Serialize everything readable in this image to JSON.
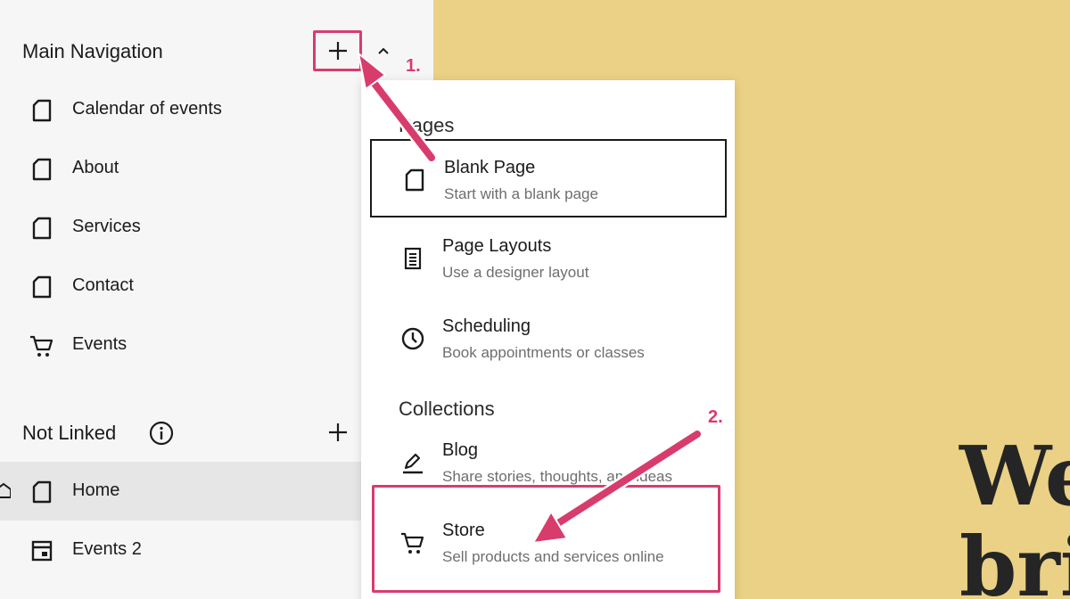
{
  "sidebar": {
    "main_nav_title": "Main Navigation",
    "main_nav_items": [
      {
        "label": "Calendar of events",
        "icon": "page-icon"
      },
      {
        "label": "About",
        "icon": "page-icon"
      },
      {
        "label": "Services",
        "icon": "page-icon"
      },
      {
        "label": "Contact",
        "icon": "page-icon"
      },
      {
        "label": "Events",
        "icon": "cart-icon"
      }
    ],
    "not_linked_title": "Not Linked",
    "not_linked_items": [
      {
        "label": "Home",
        "icon": "page-icon",
        "selected": true
      },
      {
        "label": "Events 2",
        "icon": "calendar-page-icon"
      }
    ]
  },
  "dropdown": {
    "pages_heading": "Pages",
    "pages_items": [
      {
        "title": "Blank Page",
        "desc": "Start with a blank page",
        "icon": "page-icon"
      },
      {
        "title": "Page Layouts",
        "desc": "Use a designer layout",
        "icon": "layout-icon"
      },
      {
        "title": "Scheduling",
        "desc": "Book appointments or classes",
        "icon": "clock-icon"
      }
    ],
    "collections_heading": "Collections",
    "collections_items": [
      {
        "title": "Blog",
        "desc": "Share stories, thoughts, and ideas",
        "icon": "blog-icon"
      },
      {
        "title": "Store",
        "desc": "Sell products and services online",
        "icon": "cart-icon"
      }
    ]
  },
  "annotations": {
    "step1": "1.",
    "step2": "2.",
    "color": "#d83c6c"
  },
  "hero": {
    "line1": "We",
    "line2": "bri"
  },
  "colors": {
    "background": "#ebd185",
    "sidebar": "#f6f6f6",
    "selected_row": "#e6e6e6"
  }
}
